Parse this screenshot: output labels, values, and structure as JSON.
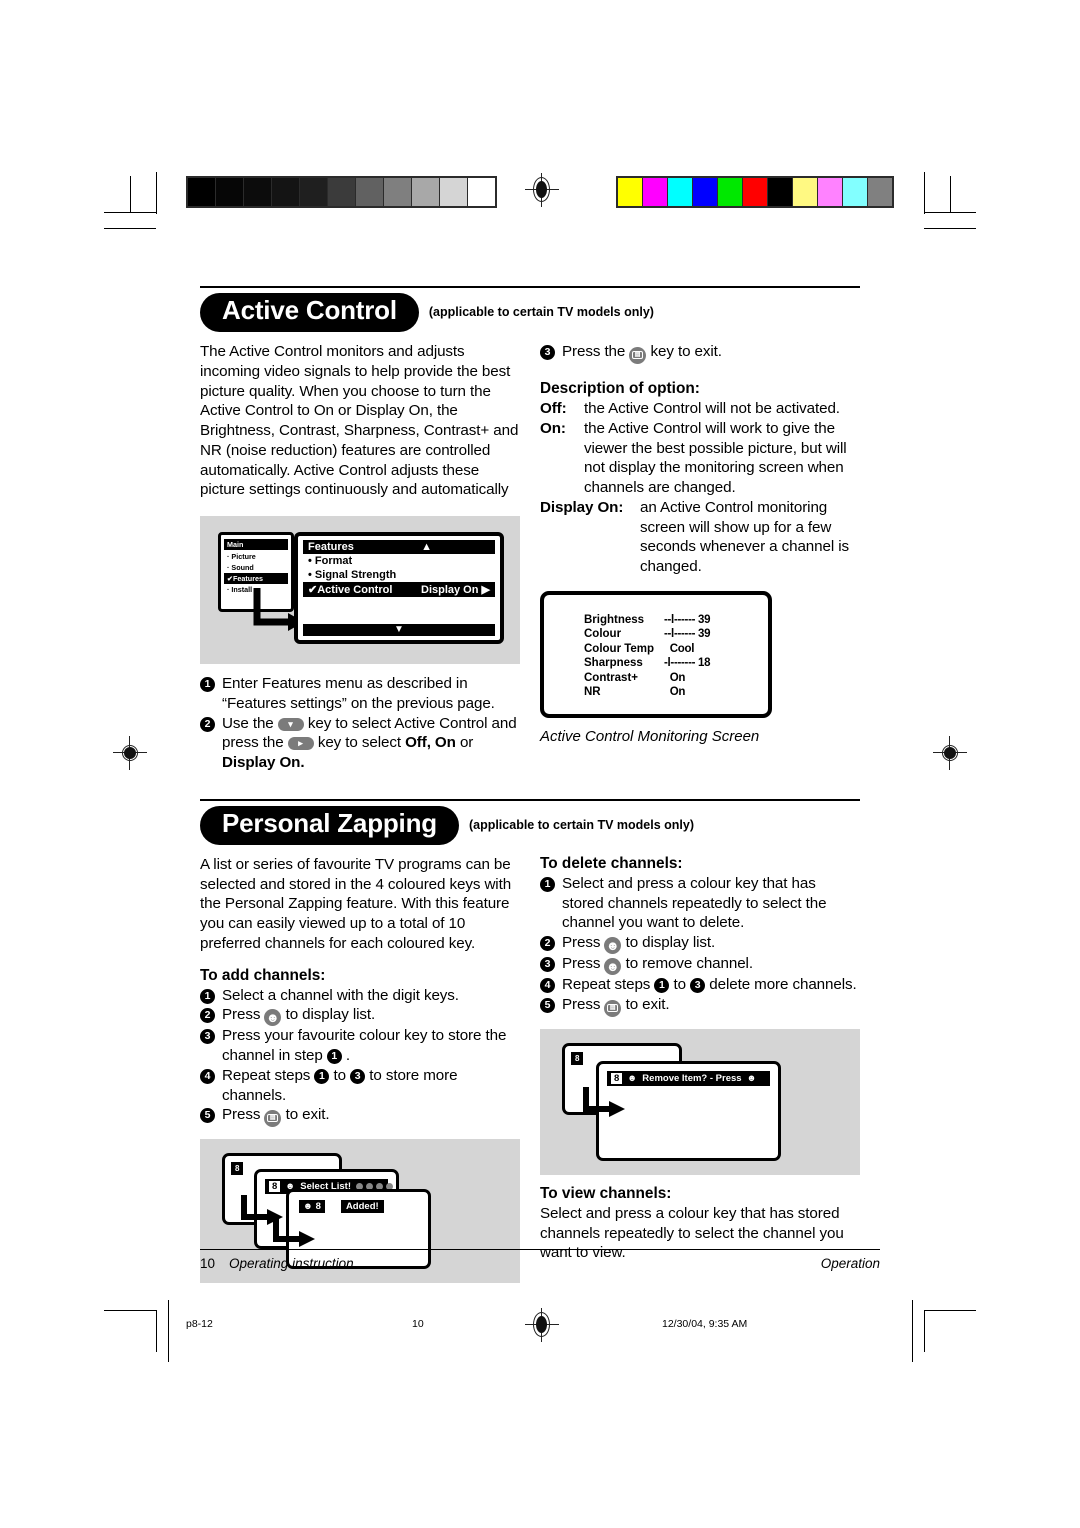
{
  "calibration": {
    "gray_bar": [
      "#000000",
      "#060606",
      "#0c0c0c",
      "#141414",
      "#1f1f1f",
      "#3b3b3b",
      "#616161",
      "#7f7f7f",
      "#a8a8a8",
      "#d5d5d5",
      "#ffffff"
    ],
    "color_bar": [
      "#ffff00",
      "#ff00ff",
      "#00ffff",
      "#0000ff",
      "#00e800",
      "#ff0000",
      "#000000",
      "#fff982",
      "#ff82ff",
      "#82ffff",
      "#808080"
    ]
  },
  "sections": [
    {
      "title": "Active Control",
      "note": "(applicable to certain TV models only)"
    },
    {
      "title": "Personal Zapping",
      "note": "(applicable to certain TV models only)"
    }
  ],
  "active_control": {
    "intro": "The Active Control monitors and adjusts incoming video signals to help provide the best picture quality. When you choose to turn the Active Control to On or Display On, the Brightness, Contrast, Sharpness, Contrast+ and NR (noise reduction) features are controlled automatically.  Active Control adjusts these picture settings continuously and automatically",
    "menu_illustration": {
      "main_title": "Main",
      "main_items": [
        "Picture",
        "Sound",
        "Features",
        "Install"
      ],
      "main_selected": "Features",
      "panel_title": "Features",
      "panel_items": [
        "Format",
        "Signal Strength"
      ],
      "panel_selected_label": "Active Control",
      "panel_selected_value": "Display On",
      "up_arrow": "▲",
      "down_arrow": "▼",
      "right_arrow": "▶",
      "check": "✔"
    },
    "steps": [
      {
        "n": "1",
        "parts": [
          {
            "t": "text",
            "v": "Enter Features menu as described in “Features settings” on the previous page."
          }
        ]
      },
      {
        "n": "2",
        "parts": [
          {
            "t": "text",
            "v": "Use the "
          },
          {
            "t": "key",
            "v": "▾",
            "kind": "dpad"
          },
          {
            "t": "text",
            "v": " key to select Active Control and press the "
          },
          {
            "t": "key",
            "v": "▸",
            "kind": "dpad"
          },
          {
            "t": "text",
            "v": " key to select "
          },
          {
            "t": "bold",
            "v": "Off, On"
          },
          {
            "t": "text",
            "v": " or "
          },
          {
            "t": "bold",
            "v": "Display On."
          }
        ]
      }
    ],
    "step3": {
      "n": "3",
      "before": "Press the ",
      "key": "MENU",
      "after": " key to exit."
    },
    "description_heading": "Description of option:",
    "options": [
      {
        "term": "Off:",
        "desc": "the Active Control will not be activated."
      },
      {
        "term": "On:",
        "desc": "the Active Control will work to give the viewer the best possible picture, but will not display the monitoring screen when channels are changed."
      },
      {
        "term": "Display On:",
        "desc": "an Active Control monitoring screen will show up for a few seconds whenever a channel is changed."
      }
    ],
    "monitoring_screen": {
      "rows": [
        {
          "label": "Brightness",
          "value": "--l------ 39"
        },
        {
          "label": "Colour",
          "value": "--l------ 39"
        },
        {
          "label": "Colour Temp",
          "value": "  Cool"
        },
        {
          "label": "Sharpness",
          "value": "-l------- 18"
        },
        {
          "label": "Contrast+",
          "value": "  On"
        },
        {
          "label": "NR",
          "value": "  On"
        }
      ],
      "caption": "Active Control Monitoring Screen"
    }
  },
  "personal_zapping": {
    "intro": "A list or series of favourite TV programs can be selected and stored in the 4 coloured keys with the Personal Zapping feature. With this feature you can easily viewed up to a total of 10 preferred channels for each coloured key.",
    "add_heading": "To add channels:",
    "add_steps": [
      {
        "n": "1",
        "text": "Select a channel with the digit keys."
      },
      {
        "n": "2",
        "before": "Press ",
        "key": "smiley",
        "after": " to display list."
      },
      {
        "n": "3",
        "text": "Press your favourite colour key to store the channel in step ",
        "ref": "1",
        "tail": " ."
      },
      {
        "n": "4",
        "before": "Repeat steps ",
        "ref1": "1",
        "mid": " to ",
        "ref2": "3",
        "after": " to store more channels."
      },
      {
        "n": "5",
        "before": "Press ",
        "key": "MENU",
        "after": " to exit."
      }
    ],
    "add_illustration": {
      "screen1_num": "8",
      "screen2_num": "8",
      "screen2_label": "Select List!",
      "screen3_num": "8",
      "screen3_label": "Added!"
    },
    "delete_heading": "To delete channels:",
    "delete_steps": [
      {
        "n": "1",
        "text": "Select and press a colour key that has stored channels repeatedly to select the channel you want to delete."
      },
      {
        "n": "2",
        "before": "Press ",
        "key": "smiley",
        "after": " to display list."
      },
      {
        "n": "3",
        "before": "Press ",
        "key": "smiley",
        "after": " to remove channel."
      },
      {
        "n": "4",
        "before": "Repeat steps ",
        "ref1": "1",
        "mid": " to ",
        "ref2": "3",
        "after": " delete more channels."
      },
      {
        "n": "5",
        "before": "Press ",
        "key": "MENU",
        "after": " to exit."
      }
    ],
    "delete_illustration": {
      "screen1_num": "8",
      "screen2_num": "8",
      "screen2_label": "Remove Item? - Press"
    },
    "view_heading": "To view channels:",
    "view_text": "Select and press a colour key that has stored channels repeatedly to select the channel you want to view."
  },
  "footer": {
    "page_number": "10",
    "left_label": "Operating instruction",
    "right_label": "Operation"
  },
  "print_info": {
    "file": "p8-12",
    "page": "10",
    "timestamp": "12/30/04, 9:35 AM"
  }
}
